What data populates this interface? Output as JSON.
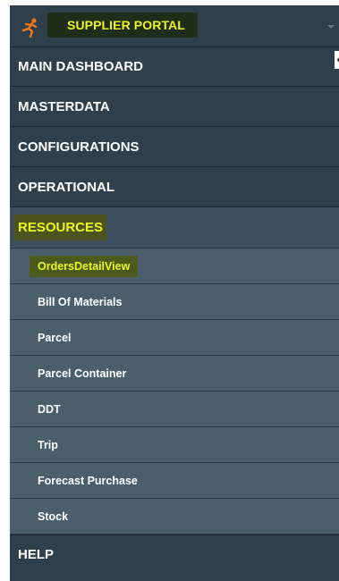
{
  "brand": {
    "title": "SUPPLIER PORTAL",
    "logo_icon": "runner-icon",
    "caret_icon": "caret-down-icon",
    "title_highlight_color": "#ecf61f"
  },
  "collapse_icon": "chevron-left-icon",
  "menu": {
    "main_dashboard": "MAIN DASHBOARD",
    "masterdata": "MASTERDATA",
    "configurations": "CONFIGURATIONS",
    "operational": "OPERATIONAL",
    "resources": "RESOURCES",
    "help": "HELP"
  },
  "resources_items": [
    {
      "label": "OrdersDetailView",
      "active": true
    },
    {
      "label": "Bill Of Materials"
    },
    {
      "label": "Parcel"
    },
    {
      "label": "Parcel Container"
    },
    {
      "label": "DDT"
    },
    {
      "label": "Trip"
    },
    {
      "label": "Forecast Purchase"
    },
    {
      "label": "Stock"
    }
  ],
  "colors": {
    "sidebar_bg": "#2f3f4c",
    "submenu_bg": "#4a5e6c",
    "highlight_text": "#ecf61f"
  }
}
